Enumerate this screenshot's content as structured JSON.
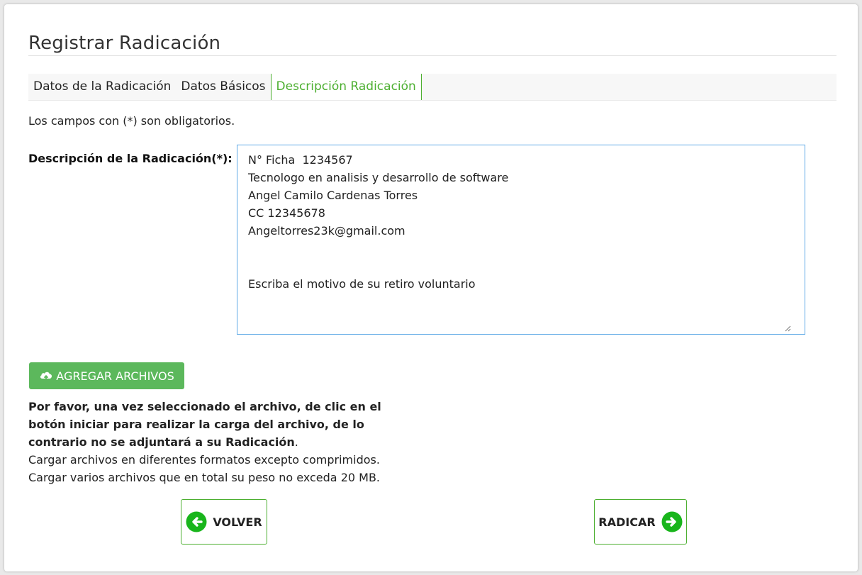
{
  "page": {
    "title": "Registrar Radicación"
  },
  "tabs": [
    {
      "label": "Datos de la Radicación",
      "active": false
    },
    {
      "label": "Datos Básicos",
      "active": false
    },
    {
      "label": "Descripción Radicación",
      "active": true
    }
  ],
  "form": {
    "required_note": "Los campos con (*) son obligatorios.",
    "description_label": "Descripción de la Radicación(*):",
    "description_value": "N° Ficha  1234567\nTecnologo en analisis y desarrollo de software\nAngel Camilo Cardenas Torres\nCC 12345678\nAngeltorres23k@gmail.com\n\n\nEscriba el motivo de su retiro voluntario"
  },
  "upload": {
    "button_label": "AGREGAR ARCHIVOS",
    "button_icon": "cloud-upload-icon",
    "help_bold": "Por favor, una vez seleccionado el archivo, de clic en el botón iniciar para realizar la carga del archivo, de lo contrario no se adjuntará a su Radicación",
    "help_bold_suffix": ".",
    "help_line_1": "Cargar archivos en diferentes formatos excepto comprimidos.",
    "help_line_2": "Cargar varios archivos que en total su peso no exceda 20 MB."
  },
  "actions": {
    "back_label": "VOLVER",
    "back_icon": "arrow-left-circle-icon",
    "submit_label": "RADICAR",
    "submit_icon": "arrow-right-circle-icon"
  },
  "colors": {
    "accent_green": "#4caf30",
    "button_green": "#5cb85c",
    "input_border_blue": "#5ea9e6"
  }
}
